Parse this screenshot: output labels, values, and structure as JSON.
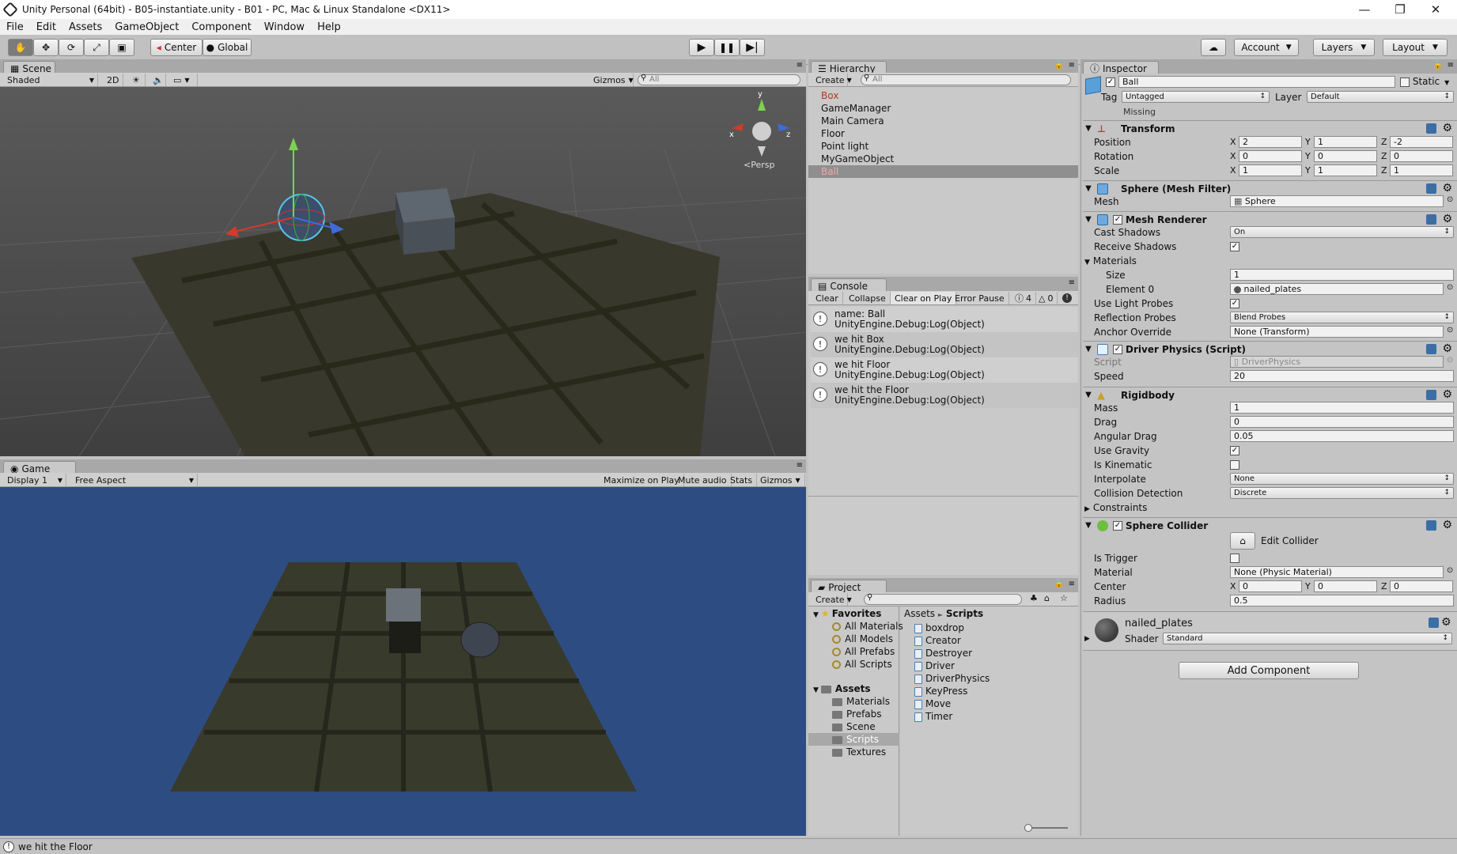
{
  "titlebar": {
    "title": "Unity Personal (64bit) - B05-instantiate.unity - B01 - PC, Mac & Linux Standalone <DX11>",
    "minimize": "—",
    "restore": "❐",
    "close": "✕"
  },
  "menu": [
    "File",
    "Edit",
    "Assets",
    "GameObject",
    "Component",
    "Window",
    "Help"
  ],
  "toolbar": {
    "center_label": "Center",
    "global_label": "Global",
    "account_label": "Account",
    "layers_label": "Layers",
    "layout_label": "Layout"
  },
  "scene": {
    "tab": "Scene",
    "shading": "Shaded",
    "mode_2d": "2D",
    "gizmos": "Gizmos",
    "search_placeholder": "All",
    "persp": "Persp",
    "axis_y": "y",
    "axis_x": "x",
    "axis_z": "z"
  },
  "game": {
    "tab": "Game",
    "display": "Display 1",
    "aspect": "Free Aspect",
    "maximize": "Maximize on Play",
    "mute": "Mute audio",
    "stats": "Stats",
    "gizmos": "Gizmos"
  },
  "hierarchy": {
    "tab": "Hierarchy",
    "create": "Create",
    "search_placeholder": "All",
    "items": [
      "Box",
      "GameManager",
      "Main Camera",
      "Floor",
      "Point light",
      "MyGameObject",
      "Ball"
    ],
    "selected": "Ball"
  },
  "console": {
    "tab": "Console",
    "clear": "Clear",
    "collapse": "Collapse",
    "clear_on_play": "Clear on Play",
    "error_pause": "Error Pause",
    "log_count": "4",
    "warn_count": "0",
    "error_count": "0",
    "entries": [
      {
        "line1": "name: Ball",
        "line2": "UnityEngine.Debug:Log(Object)"
      },
      {
        "line1": "we hit Box",
        "line2": "UnityEngine.Debug:Log(Object)"
      },
      {
        "line1": "we hit Floor",
        "line2": "UnityEngine.Debug:Log(Object)"
      },
      {
        "line1": "we hit the Floor",
        "line2": "UnityEngine.Debug:Log(Object)"
      }
    ]
  },
  "project": {
    "tab": "Project",
    "create": "Create",
    "favorites": "Favorites",
    "fav_items": [
      "All Materials",
      "All Models",
      "All Prefabs",
      "All Scripts"
    ],
    "assets": "Assets",
    "asset_folders": [
      "Materials",
      "Prefabs",
      "Scene",
      "Scripts",
      "Textures"
    ],
    "breadcrumb_root": "Assets",
    "breadcrumb_sep": "►",
    "breadcrumb_leaf": "Scripts",
    "scripts": [
      "boxdrop",
      "Creator",
      "Destroyer",
      "Driver",
      "DriverPhysics",
      "KeyPress",
      "Move",
      "Timer"
    ]
  },
  "inspector": {
    "tab": "Inspector",
    "object_name": "Ball",
    "static_label": "Static",
    "tag_label": "Tag",
    "tag_value": "Untagged",
    "layer_label": "Layer",
    "layer_value": "Default",
    "missing": "Missing",
    "transform": {
      "title": "Transform",
      "position_label": "Position",
      "rotation_label": "Rotation",
      "scale_label": "Scale",
      "pos": [
        "2",
        "1",
        "-2"
      ],
      "rot": [
        "0",
        "0",
        "0"
      ],
      "scale": [
        "1",
        "1",
        "1"
      ]
    },
    "mesh_filter": {
      "title": "Sphere (Mesh Filter)",
      "mesh_label": "Mesh",
      "mesh_value": "Sphere"
    },
    "mesh_renderer": {
      "title": "Mesh Renderer",
      "cast_shadows_label": "Cast Shadows",
      "cast_shadows": "On",
      "receive_shadows_label": "Receive Shadows",
      "materials_label": "Materials",
      "size_label": "Size",
      "size": "1",
      "element0_label": "Element 0",
      "element0": "nailed_plates",
      "light_probes_label": "Use Light Probes",
      "reflection_label": "Reflection Probes",
      "reflection": "Blend Probes",
      "anchor_label": "Anchor Override",
      "anchor": "None (Transform)"
    },
    "driver_physics": {
      "title": "Driver Physics (Script)",
      "script_label": "Script",
      "script": "DriverPhysics",
      "speed_label": "Speed",
      "speed": "20"
    },
    "rigidbody": {
      "title": "Rigidbody",
      "mass_label": "Mass",
      "mass": "1",
      "drag_label": "Drag",
      "drag": "0",
      "angular_drag_label": "Angular Drag",
      "angular_drag": "0.05",
      "gravity_label": "Use Gravity",
      "kinematic_label": "Is Kinematic",
      "interpolate_label": "Interpolate",
      "interpolate": "None",
      "collision_label": "Collision Detection",
      "collision": "Discrete",
      "constraints_label": "Constraints"
    },
    "sphere_collider": {
      "title": "Sphere Collider",
      "edit_collider": "Edit Collider",
      "trigger_label": "Is Trigger",
      "material_label": "Material",
      "material": "None (Physic Material)",
      "center_label": "Center",
      "center": [
        "0",
        "0",
        "0"
      ],
      "radius_label": "Radius",
      "radius": "0.5"
    },
    "material": {
      "name": "nailed_plates",
      "shader_label": "Shader",
      "shader": "Standard"
    },
    "add_component": "Add Component"
  },
  "status": {
    "message": "we hit the Floor"
  },
  "colors": {
    "game_bg": "#2d4d82",
    "scene_bg": "#4e4e4e",
    "selected_row": "#8f8f8f"
  }
}
